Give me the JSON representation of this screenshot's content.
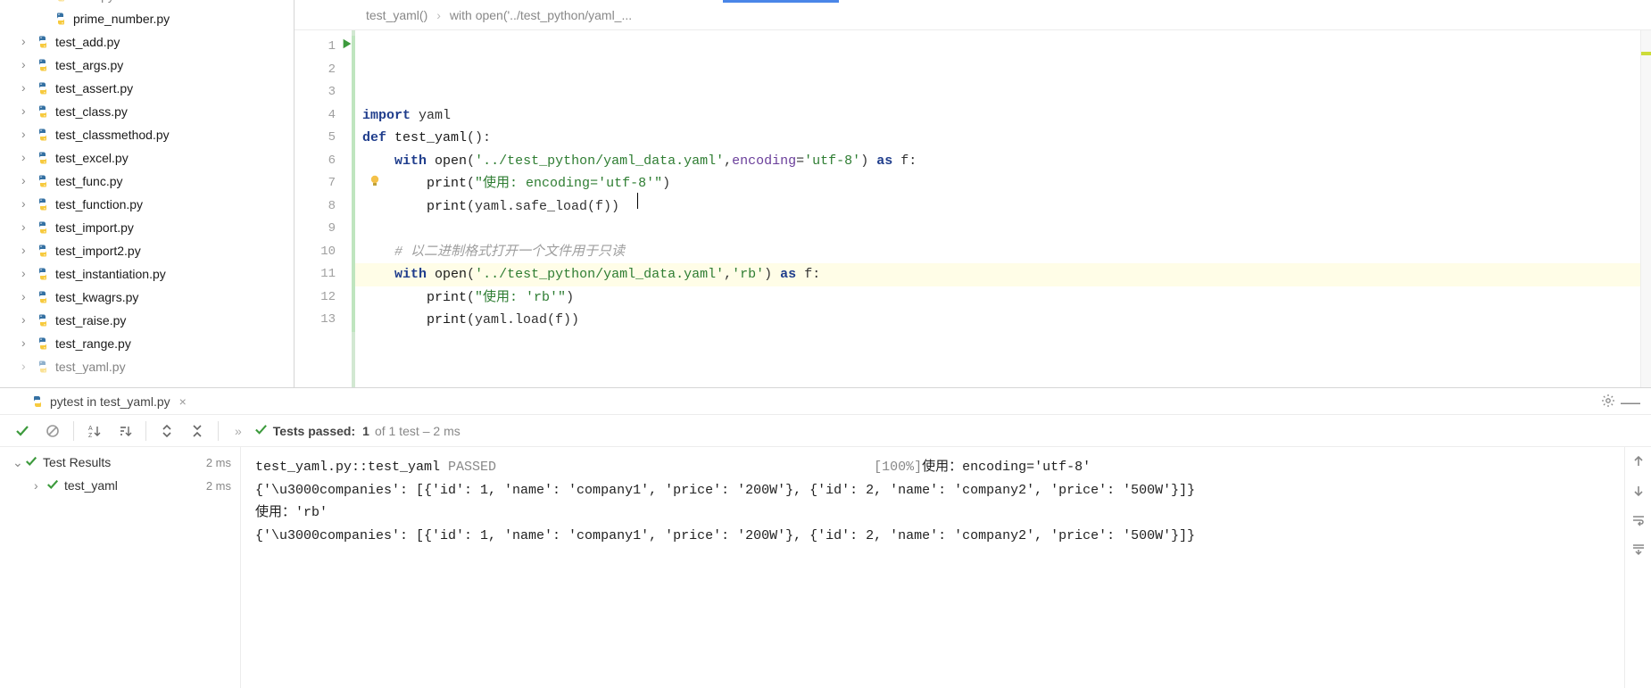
{
  "tree": {
    "items": [
      {
        "name": "num.py",
        "expandable": false,
        "cut": true,
        "level": 1
      },
      {
        "name": "prime_number.py",
        "expandable": false,
        "level": 1
      },
      {
        "name": "test_add.py",
        "expandable": true,
        "level": 0
      },
      {
        "name": "test_args.py",
        "expandable": true,
        "level": 0
      },
      {
        "name": "test_assert.py",
        "expandable": true,
        "level": 0
      },
      {
        "name": "test_class.py",
        "expandable": true,
        "level": 0
      },
      {
        "name": "test_classmethod.py",
        "expandable": true,
        "level": 0
      },
      {
        "name": "test_excel.py",
        "expandable": true,
        "level": 0
      },
      {
        "name": "test_func.py",
        "expandable": true,
        "level": 0
      },
      {
        "name": "test_function.py",
        "expandable": true,
        "level": 0
      },
      {
        "name": "test_import.py",
        "expandable": true,
        "level": 0
      },
      {
        "name": "test_import2.py",
        "expandable": true,
        "level": 0
      },
      {
        "name": "test_instantiation.py",
        "expandable": true,
        "level": 0
      },
      {
        "name": "test_kwagrs.py",
        "expandable": true,
        "level": 0
      },
      {
        "name": "test_raise.py",
        "expandable": true,
        "level": 0
      },
      {
        "name": "test_range.py",
        "expandable": true,
        "level": 0
      },
      {
        "name": "test_yaml.py",
        "expandable": true,
        "level": 0,
        "cut": true
      }
    ]
  },
  "breadcrumb": {
    "a": "test_yaml()",
    "b": "with open('../test_python/yaml_..."
  },
  "editor": {
    "lines": [
      {
        "n": 1,
        "segs": [
          [
            "kw",
            "import"
          ],
          [
            "",
            " yaml"
          ]
        ]
      },
      {
        "n": 2,
        "segs": [
          [
            "kw",
            "def"
          ],
          [
            "",
            " "
          ],
          [
            "fn",
            "test_yaml"
          ],
          [
            "",
            "():"
          ]
        ]
      },
      {
        "n": 3,
        "segs": [
          [
            "",
            "    "
          ],
          [
            "kw",
            "with"
          ],
          [
            "",
            " "
          ],
          [
            "call",
            "open"
          ],
          [
            "",
            "("
          ],
          [
            "str",
            "'../test_python/yaml_data.yaml'"
          ],
          [
            "",
            ","
          ],
          [
            "param",
            "encoding"
          ],
          [
            "",
            "="
          ],
          [
            "str",
            "'utf-8'"
          ],
          [
            "",
            ") "
          ],
          [
            "kw",
            "as"
          ],
          [
            "",
            " f:"
          ]
        ]
      },
      {
        "n": 4,
        "segs": [
          [
            "",
            "        "
          ],
          [
            "call",
            "print"
          ],
          [
            "",
            "("
          ],
          [
            "str",
            "\"使用: encoding='utf-8'\""
          ],
          [
            "",
            ")"
          ]
        ]
      },
      {
        "n": 5,
        "segs": [
          [
            "",
            "        "
          ],
          [
            "call",
            "print"
          ],
          [
            "",
            "(yaml.safe_load(f))"
          ]
        ]
      },
      {
        "n": 6,
        "segs": [
          [
            "",
            ""
          ]
        ]
      },
      {
        "n": 7,
        "segs": [
          [
            "",
            "    "
          ],
          [
            "cmt",
            "# 以二进制格式打开一个文件用于只读"
          ]
        ]
      },
      {
        "n": 8,
        "hl": true,
        "segs": [
          [
            "",
            "    "
          ],
          [
            "kw",
            "with"
          ],
          [
            "",
            " "
          ],
          [
            "call",
            "open"
          ],
          [
            "",
            "("
          ],
          [
            "str",
            "'../test_python/yaml_data.yaml'"
          ],
          [
            "",
            ","
          ],
          [
            "str",
            "'rb'"
          ],
          [
            "",
            ") "
          ],
          [
            "kw",
            "as"
          ],
          [
            "",
            " f:"
          ]
        ]
      },
      {
        "n": 9,
        "segs": [
          [
            "",
            "        "
          ],
          [
            "call",
            "print"
          ],
          [
            "",
            "("
          ],
          [
            "str",
            "\"使用: 'rb'\""
          ],
          [
            "",
            ")"
          ]
        ]
      },
      {
        "n": 10,
        "segs": [
          [
            "",
            "        "
          ],
          [
            "call",
            "print"
          ],
          [
            "",
            "(yaml.load(f))"
          ]
        ]
      },
      {
        "n": 11,
        "segs": [
          [
            "",
            ""
          ]
        ]
      },
      {
        "n": 12,
        "segs": [
          [
            "",
            ""
          ]
        ]
      },
      {
        "n": 13,
        "segs": [
          [
            "",
            ""
          ]
        ]
      }
    ]
  },
  "runTab": {
    "label": "pytest in test_yaml.py"
  },
  "summary": {
    "prefix": "Tests passed:",
    "count": "1",
    "of": " of 1 test",
    "dash": " – 2 ms"
  },
  "results": {
    "root": {
      "label": "Test Results",
      "time": "2 ms"
    },
    "child": {
      "label": "test_yaml",
      "time": "2 ms"
    }
  },
  "console": {
    "lines": [
      {
        "left": "test_yaml.py::test_yaml ",
        "mid_grey": "PASSED",
        "right_grey": "[100%]",
        "right": "使用：encoding='utf-8'"
      },
      {
        "left": "{'\\u3000companies': [{'id': 1, 'name': 'company1', 'price': '200W'}, {'id': 2, 'name': 'company2', 'price': '500W'}]}"
      },
      {
        "left": "使用：'rb'"
      },
      {
        "left": "{'\\u3000companies': [{'id': 1, 'name': 'company1', 'price': '200W'}, {'id': 2, 'name': 'company2', 'price': '500W'}]}"
      }
    ]
  }
}
